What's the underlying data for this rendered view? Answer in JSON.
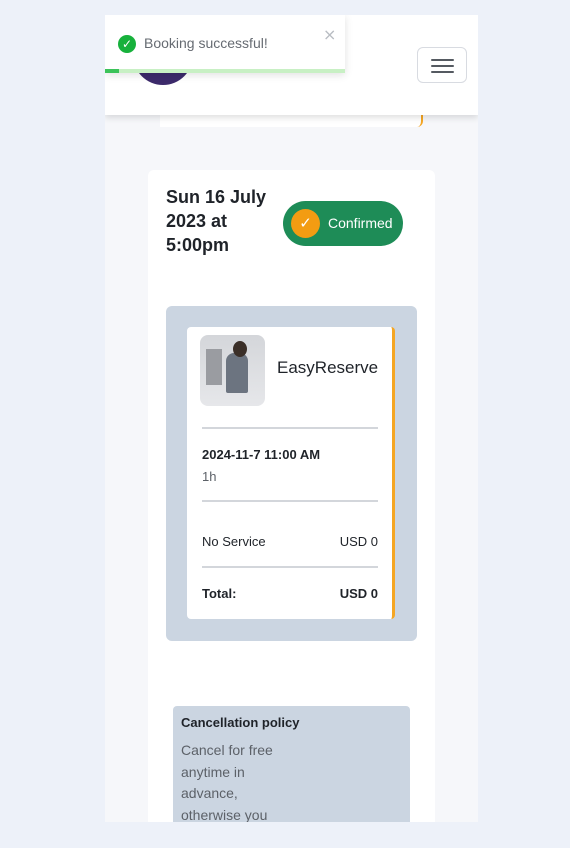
{
  "toast": {
    "message": "Booking successful!",
    "close_symbol": "×",
    "check_symbol": "✓",
    "progress_fraction": 0.06,
    "color": "#17b13c"
  },
  "header": {
    "logo_icon": "business-logo",
    "menu_icon": "hamburger-menu-icon"
  },
  "booking": {
    "date_text": "Sun 16 July 2023 at 5:00pm",
    "status": {
      "label": "Confirmed",
      "check_symbol": "✓",
      "color": "#1e8c57",
      "icon_color": "#f39c12"
    },
    "business_name": "EasyReserve",
    "appointment_datetime": "2024-11-7 11:00 AM",
    "duration": "1h",
    "service_name": "No Service",
    "service_price": "USD 0",
    "total_label": "Total:",
    "total_value": "USD 0",
    "accent_color": "#f5a623"
  },
  "policy": {
    "title": "Cancellation policy",
    "text": "Cancel for free anytime in advance, otherwise you"
  }
}
